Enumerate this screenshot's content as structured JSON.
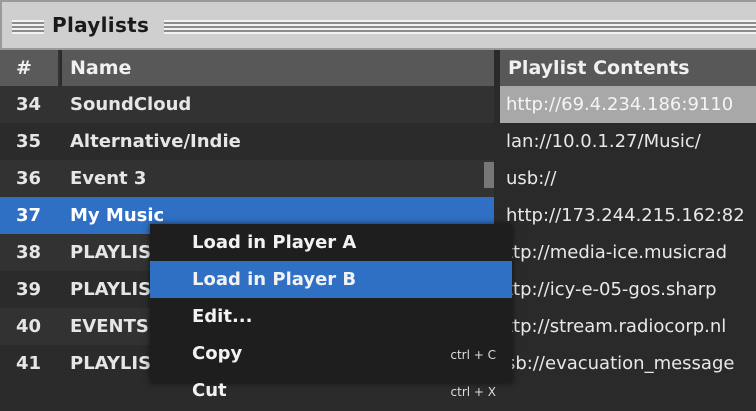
{
  "panel": {
    "title": "Playlists"
  },
  "headers": {
    "num": "#",
    "name": "Name",
    "contents": "Playlist Contents"
  },
  "rows": [
    {
      "num": "34",
      "name": "SoundCloud"
    },
    {
      "num": "35",
      "name": "Alternative/Indie"
    },
    {
      "num": "36",
      "name": "Event 3"
    },
    {
      "num": "37",
      "name": "My Music"
    },
    {
      "num": "38",
      "name": "PLAYLIS"
    },
    {
      "num": "39",
      "name": "PLAYLIS"
    },
    {
      "num": "40",
      "name": "EVENTS"
    },
    {
      "num": "41",
      "name": "PLAYLIS"
    }
  ],
  "contents": [
    "http://69.4.234.186:9110",
    "lan://10.0.1.27/Music/",
    "usb://",
    "http://173.244.215.162:82",
    "ttp://media-ice.musicrad",
    "ttp://icy-e-05-gos.sharp",
    "ttp://stream.radiocorp.nl",
    "sb://evacuation_message"
  ],
  "context_menu": {
    "items": [
      {
        "label": "Load in Player A",
        "shortcut": ""
      },
      {
        "label": "Load in Player B",
        "shortcut": ""
      },
      {
        "label": "Edit...",
        "shortcut": ""
      },
      {
        "label": "Copy",
        "shortcut": "ctrl + C"
      },
      {
        "label": "Cut",
        "shortcut": "ctrl + X"
      }
    ]
  },
  "colors": {
    "selection": "#2f6fc4",
    "highlight": "#a8a8a8"
  }
}
